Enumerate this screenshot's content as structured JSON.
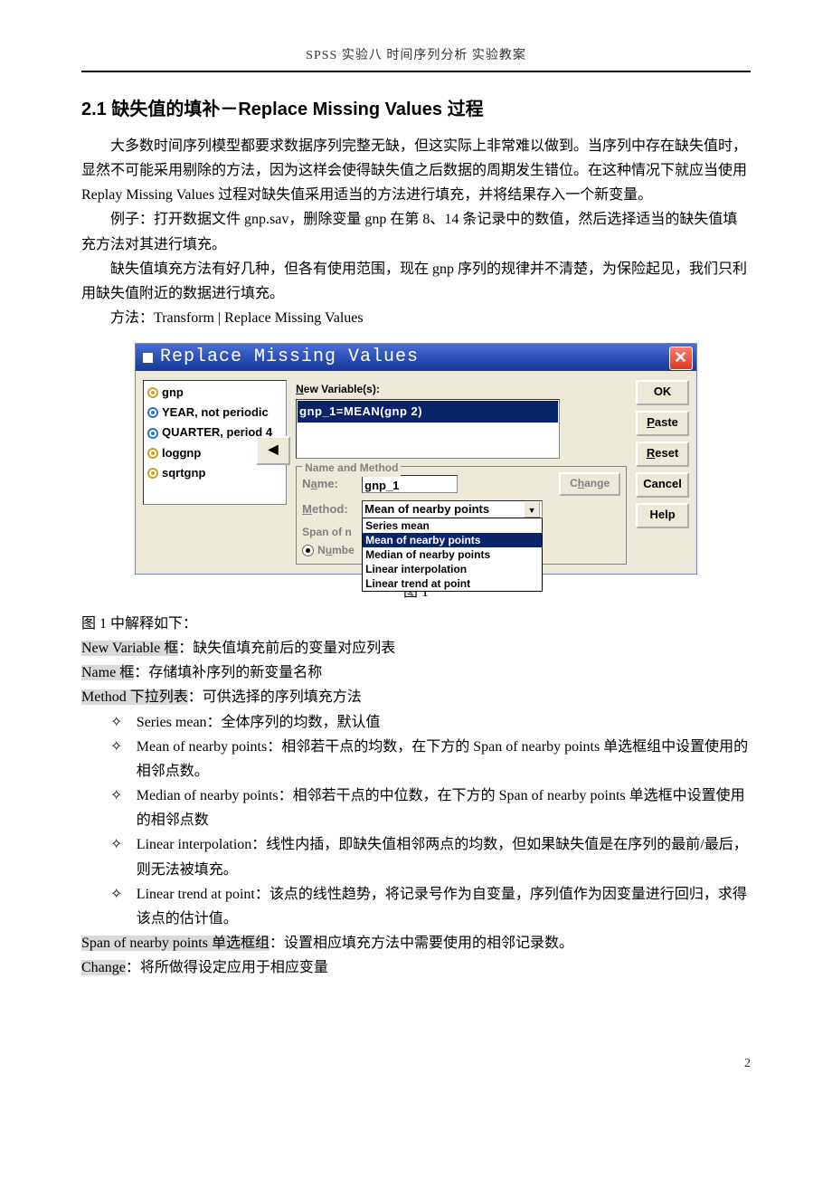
{
  "header": "SPSS 实验八 时间序列分析 实验教案",
  "section_title": "2.1 缺失值的填补－Replace Missing Values 过程",
  "paragraphs": {
    "p1": "大多数时间序列模型都要求数据序列完整无缺，但这实际上非常难以做到。当序列中存在缺失值时，显然不可能采用剔除的方法，因为这样会使得缺失值之后数据的周期发生错位。在这种情况下就应当使用 Replay Missing Values 过程对缺失值采用适当的方法进行填充，并将结果存入一个新变量。",
    "p2": "例子：打开数据文件 gnp.sav，删除变量 gnp 在第 8、14 条记录中的数值，然后选择适当的缺失值填充方法对其进行填充。",
    "p3": "缺失值填充方法有好几种，但各有使用范围，现在 gnp 序列的规律并不清楚，为保险起见，我们只利用缺失值附近的数据进行填充。",
    "p4": "方法：Transform | Replace Missing Values"
  },
  "dialog": {
    "title": "Replace Missing Values",
    "close_glyph": "✕",
    "vars": [
      "gnp",
      "YEAR, not periodic",
      "QUARTER, period 4",
      "loggnp",
      "sqrtgnp"
    ],
    "newvar_label": "New Variable(s):",
    "newvar_selected": "gnp_1=MEAN(gnp 2)",
    "arrow_glyph": "◀",
    "fieldset_legend": "Name and Method",
    "name_label": "Name:",
    "name_value": "gnp_1",
    "method_label": "Method:",
    "method_value": "Mean of nearby points",
    "method_options": [
      "Series mean",
      "Mean of nearby points",
      "Median of nearby points",
      "Linear interpolation",
      "Linear trend at point"
    ],
    "span_label_prefix": "Span of n",
    "span_number_label": "Numbe",
    "change_label": "Change",
    "buttons": {
      "ok": "OK",
      "paste": "Paste",
      "reset": "Reset",
      "cancel": "Cancel",
      "help": "Help"
    }
  },
  "caption": "图 1",
  "explain_intro": "图 1 中解释如下：",
  "explain": {
    "newvar_k": "New Variable 框",
    "newvar_v": "：缺失值填充前后的变量对应列表",
    "name_k": "Name 框",
    "name_v": "：存储填补序列的新变量名称",
    "method_k": "Method 下拉列表",
    "method_v": "：可供选择的序列填充方法"
  },
  "bullets": [
    "Series mean：全体序列的均数，默认值",
    "Mean of nearby points：相邻若干点的均数，在下方的 Span of nearby points 单选框组中设置使用的相邻点数。",
    "Median of nearby points：相邻若干点的中位数，在下方的 Span of nearby points 单选框中设置使用的相邻点数",
    "Linear interpolation：线性内插，即缺失值相邻两点的均数，但如果缺失值是在序列的最前/最后，则无法被填充。",
    "Linear trend at point：该点的线性趋势，将记录号作为自变量，序列值作为因变量进行回归，求得该点的估计值。"
  ],
  "tail": {
    "span_k": "Span of nearby points 单选框组",
    "span_v": "：设置相应填充方法中需要使用的相邻记录数。",
    "change_k": "Change",
    "change_v": "：将所做得设定应用于相应变量"
  },
  "page_number": "2"
}
